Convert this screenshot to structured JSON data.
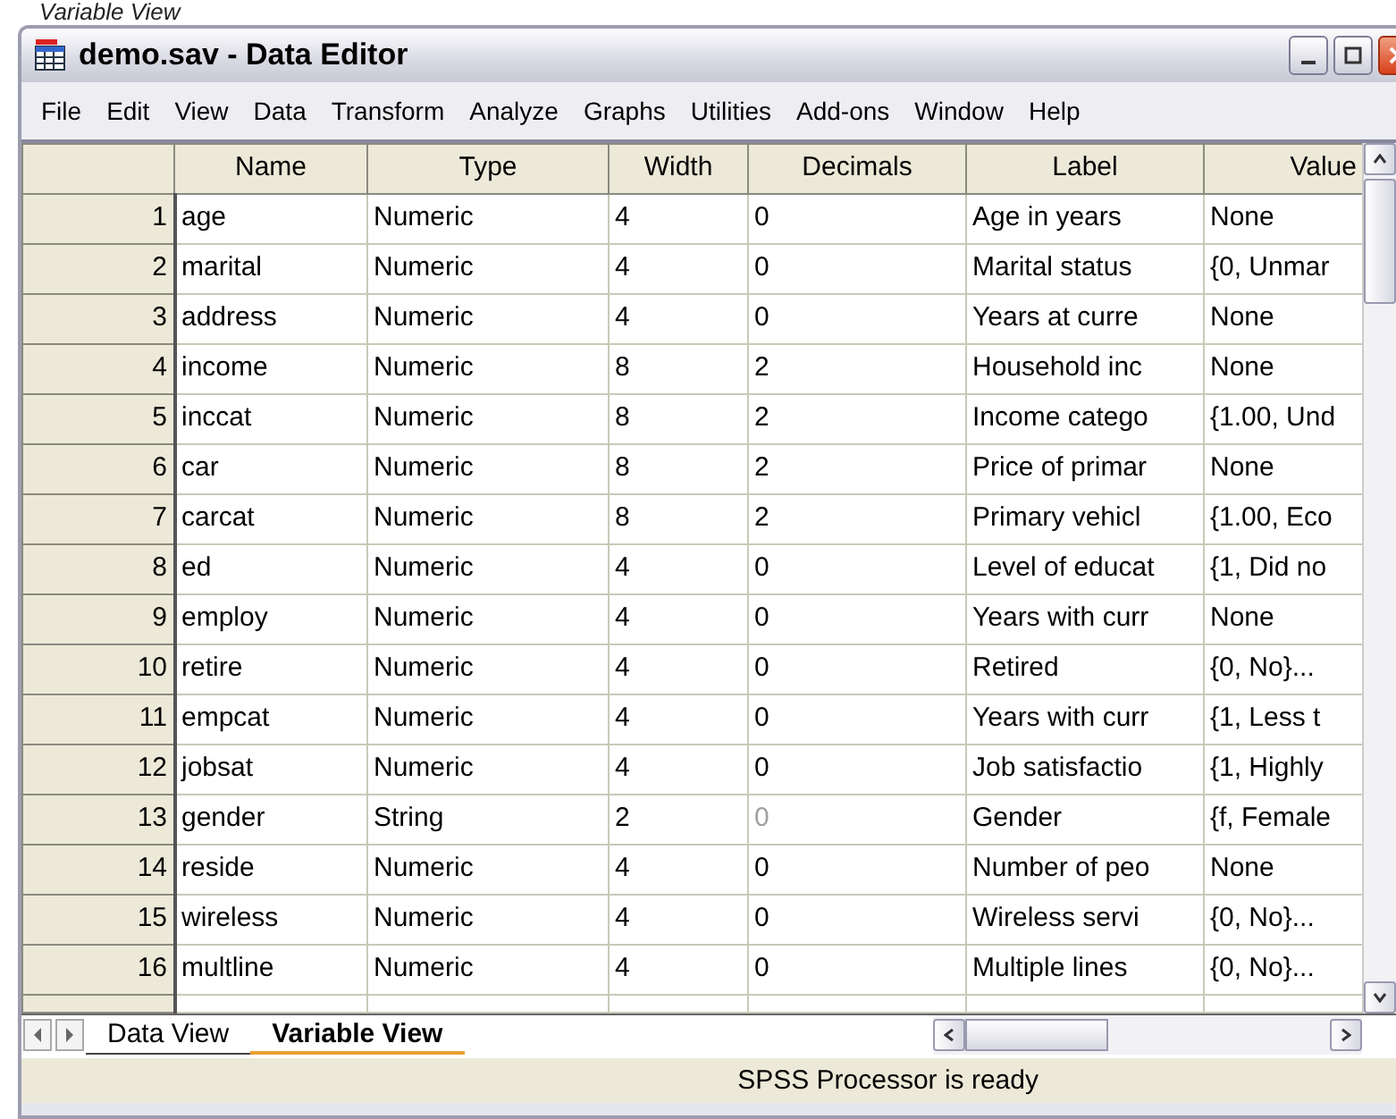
{
  "caption": "Variable View",
  "window": {
    "title": "demo.sav - Data Editor"
  },
  "menu": [
    "File",
    "Edit",
    "View",
    "Data",
    "Transform",
    "Analyze",
    "Graphs",
    "Utilities",
    "Add-ons",
    "Window",
    "Help"
  ],
  "table": {
    "columns": [
      "Name",
      "Type",
      "Width",
      "Decimals",
      "Label",
      "Value"
    ],
    "rows": [
      {
        "number": "1",
        "cells": [
          "age",
          "Numeric",
          "4",
          "0",
          "Age in years",
          "None"
        ],
        "decimals_disabled": false
      },
      {
        "number": "2",
        "cells": [
          "marital",
          "Numeric",
          "4",
          "0",
          "Marital status",
          "{0, Unmar"
        ],
        "decimals_disabled": false
      },
      {
        "number": "3",
        "cells": [
          "address",
          "Numeric",
          "4",
          "0",
          "Years at curre",
          "None"
        ],
        "decimals_disabled": false
      },
      {
        "number": "4",
        "cells": [
          "income",
          "Numeric",
          "8",
          "2",
          "Household inc",
          "None"
        ],
        "decimals_disabled": false
      },
      {
        "number": "5",
        "cells": [
          "inccat",
          "Numeric",
          "8",
          "2",
          "Income catego",
          "{1.00, Und"
        ],
        "decimals_disabled": false
      },
      {
        "number": "6",
        "cells": [
          "car",
          "Numeric",
          "8",
          "2",
          "Price of primar",
          "None"
        ],
        "decimals_disabled": false
      },
      {
        "number": "7",
        "cells": [
          "carcat",
          "Numeric",
          "8",
          "2",
          "Primary vehicl",
          "{1.00, Eco"
        ],
        "decimals_disabled": false
      },
      {
        "number": "8",
        "cells": [
          "ed",
          "Numeric",
          "4",
          "0",
          "Level of educat",
          "{1, Did no"
        ],
        "decimals_disabled": false
      },
      {
        "number": "9",
        "cells": [
          "employ",
          "Numeric",
          "4",
          "0",
          "Years with curr",
          "None"
        ],
        "decimals_disabled": false
      },
      {
        "number": "10",
        "cells": [
          "retire",
          "Numeric",
          "4",
          "0",
          "Retired",
          "{0, No}..."
        ],
        "decimals_disabled": false
      },
      {
        "number": "11",
        "cells": [
          "empcat",
          "Numeric",
          "4",
          "0",
          "Years with curr",
          "{1, Less t"
        ],
        "decimals_disabled": false
      },
      {
        "number": "12",
        "cells": [
          "jobsat",
          "Numeric",
          "4",
          "0",
          "Job satisfactio",
          "{1, Highly"
        ],
        "decimals_disabled": false
      },
      {
        "number": "13",
        "cells": [
          "gender",
          "String",
          "2",
          "0",
          "Gender",
          "{f, Female"
        ],
        "decimals_disabled": true
      },
      {
        "number": "14",
        "cells": [
          "reside",
          "Numeric",
          "4",
          "0",
          "Number of peo",
          "None"
        ],
        "decimals_disabled": false
      },
      {
        "number": "15",
        "cells": [
          "wireless",
          "Numeric",
          "4",
          "0",
          "Wireless servi",
          "{0, No}..."
        ],
        "decimals_disabled": false
      },
      {
        "number": "16",
        "cells": [
          "multline",
          "Numeric",
          "4",
          "0",
          "Multiple lines",
          "{0, No}..."
        ],
        "decimals_disabled": false
      }
    ]
  },
  "tabs": [
    {
      "label": "Data View",
      "selected": false
    },
    {
      "label": "Variable View",
      "selected": true
    }
  ],
  "status_bar": "SPSS Processor is ready"
}
